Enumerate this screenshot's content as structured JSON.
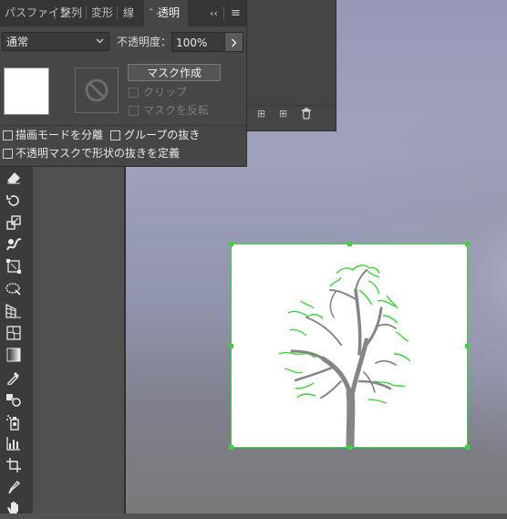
{
  "tabs": [
    {
      "label": "パスファインダー",
      "display": "パスファイン"
    },
    {
      "label": "整列"
    },
    {
      "label": "変形"
    },
    {
      "label": "線"
    },
    {
      "label": "透明"
    }
  ],
  "tab_overflow_icon": "double-chevron-left-icon",
  "panel_menu_icon": "hamburger-menu-icon",
  "transparency": {
    "blend_mode": "通常",
    "opacity_label": "不透明度：",
    "opacity_value": "100%",
    "make_mask_label": "マスク作成",
    "clip_label": "クリップ",
    "invert_mask_label": "マスクを反転",
    "isolate_blending_label": "描画モードを分離",
    "knockout_group_label": "グループの抜き",
    "opacity_mask_define_label": "不透明マスクで形状の抜きを定義"
  },
  "colors": {
    "selection": "#3bd33b",
    "tree_trunk": "#858585",
    "leaves": "#3bd33b"
  },
  "tools": [
    "eraser-icon",
    "rotate-icon",
    "scale-icon",
    "warp-icon",
    "free-transform-icon",
    "shape-builder-icon",
    "perspective-grid-icon",
    "mesh-icon",
    "gradient-icon",
    "eyedropper-icon",
    "blend-icon",
    "symbol-sprayer-icon",
    "column-graph-icon",
    "artboard-icon",
    "slice-icon",
    "hand-icon"
  ]
}
